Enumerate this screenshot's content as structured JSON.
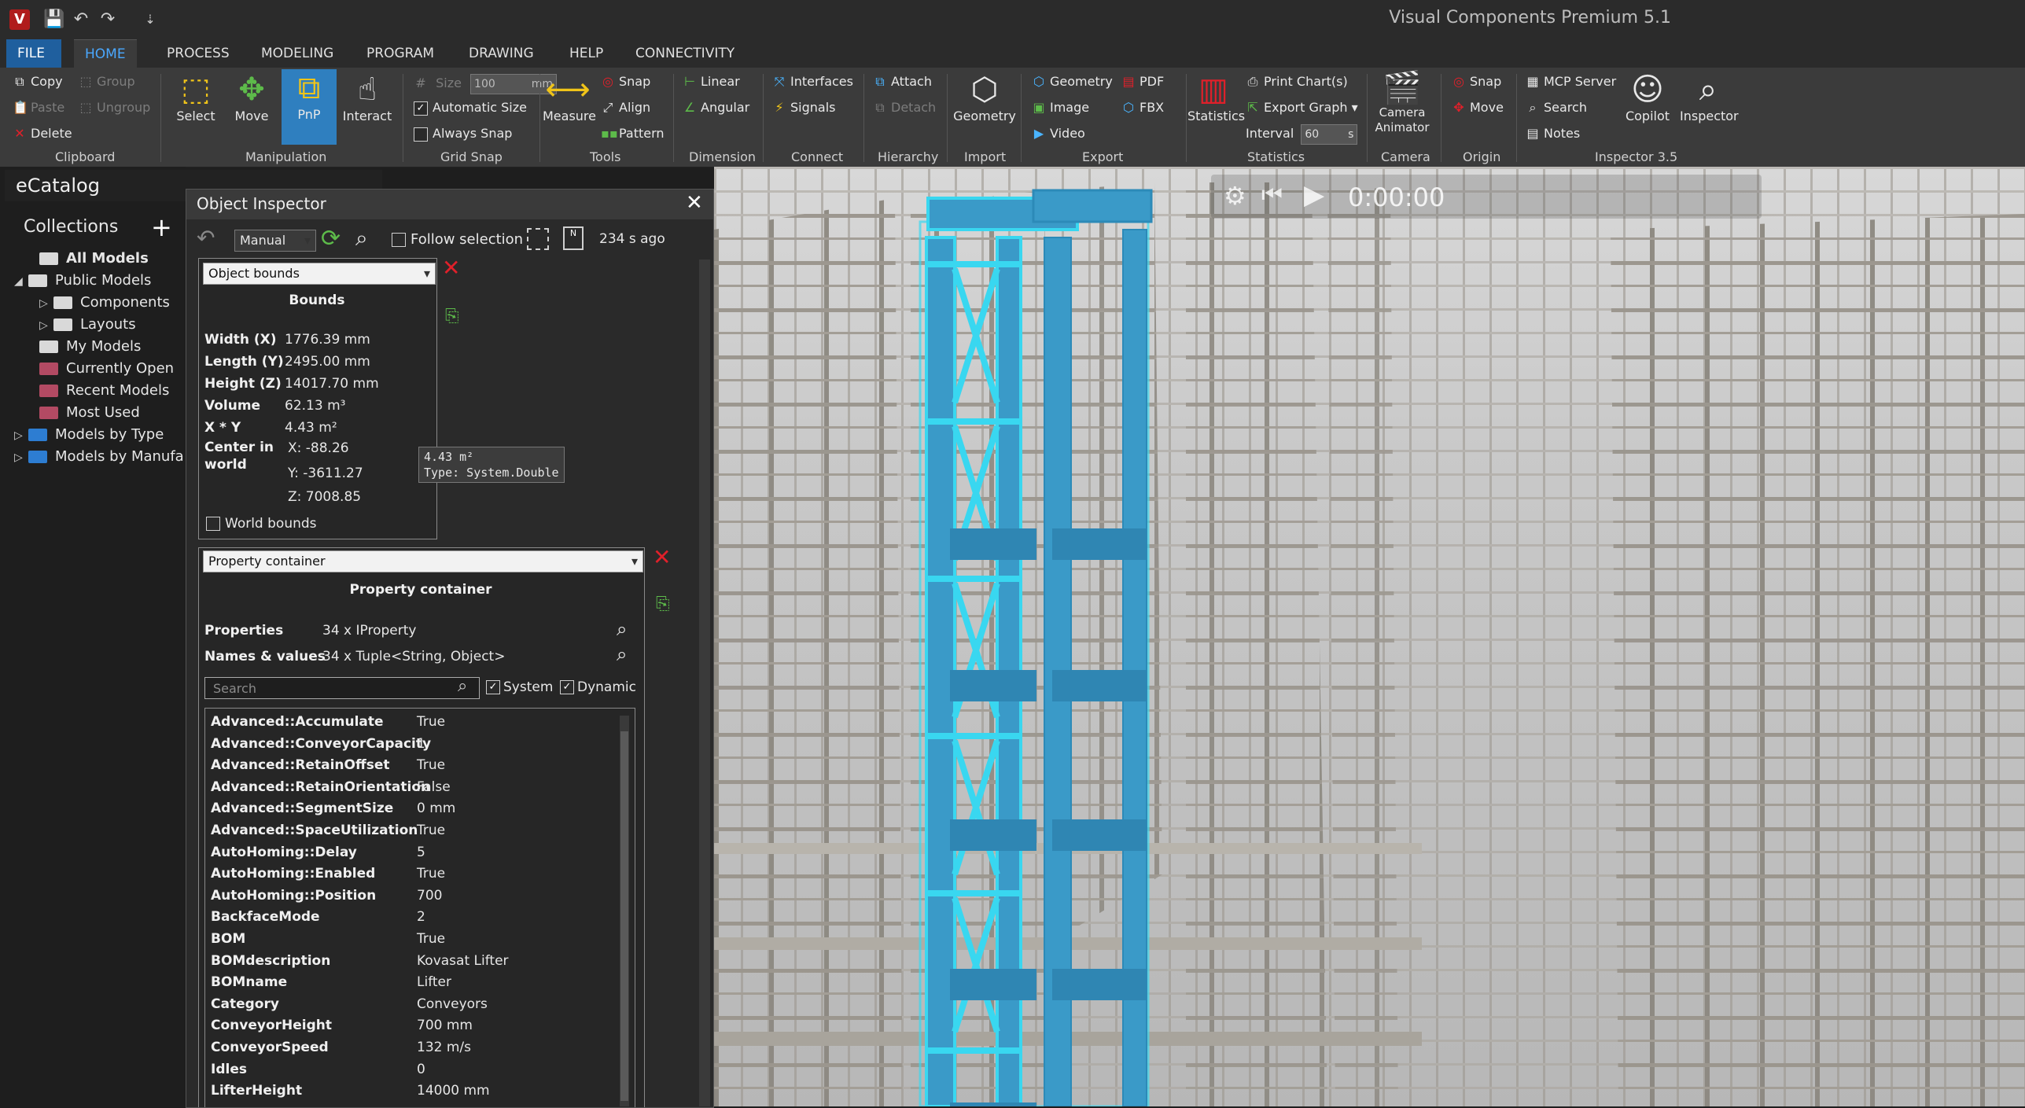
{
  "window": {
    "title": "Visual Components Premium 5.1",
    "logo": "V"
  },
  "qat": {
    "save": "💾",
    "undo": "↶",
    "redo": "↷",
    "more": "⇣"
  },
  "tabs": [
    "FILE",
    "HOME",
    "PROCESS",
    "MODELING",
    "PROGRAM",
    "DRAWING",
    "HELP",
    "CONNECTIVITY"
  ],
  "ribbon": {
    "clipboard": {
      "copy": "Copy",
      "paste": "Paste",
      "delete": "Delete",
      "group": "Group",
      "ungroup": "Ungroup",
      "label": "Clipboard"
    },
    "manipulation": {
      "select": "Select",
      "move": "Move",
      "pnp": "PnP",
      "interact": "Interact",
      "label": "Manipulation"
    },
    "grid_snap": {
      "size_label": "Size",
      "size_value": "100",
      "size_unit": "mm",
      "automatic_size": "Automatic Size",
      "always_snap": "Always Snap",
      "label": "Grid Snap"
    },
    "tools": {
      "measure": "Measure",
      "snap": "Snap",
      "align": "Align",
      "pattern": "Pattern",
      "label": "Tools"
    },
    "dimension": {
      "linear": "Linear",
      "angular": "Angular",
      "label": "Dimension"
    },
    "connect": {
      "interfaces": "Interfaces",
      "signals": "Signals",
      "label": "Connect"
    },
    "hierarchy": {
      "attach": "Attach",
      "detach": "Detach",
      "label": "Hierarchy"
    },
    "import": {
      "geometry": "Geometry",
      "label": "Import"
    },
    "export": {
      "geometry": "Geometry",
      "image": "Image",
      "video": "Video",
      "pdf": "PDF",
      "fbx": "FBX",
      "label": "Export"
    },
    "statistics": {
      "statistics": "Statistics",
      "print_charts": "Print Chart(s)",
      "export_graph": "Export Graph ▾",
      "interval_label": "Interval",
      "interval_value": "60",
      "interval_unit": "s",
      "label": "Statistics"
    },
    "camera": {
      "camera_animator": "Camera Animator",
      "label": "Camera"
    },
    "origin": {
      "snap": "Snap",
      "move": "Move",
      "label": "Origin"
    },
    "inspector": {
      "mcp_server": "MCP Server",
      "search": "Search",
      "notes": "Notes",
      "copilot": "Copilot",
      "inspector": "Inspector",
      "label": "Inspector 3.5"
    }
  },
  "ecatalog": {
    "title": "eCatalog",
    "collections_label": "Collections",
    "tree": [
      {
        "label": "All Models",
        "bold": true
      },
      {
        "label": "Public Models"
      },
      {
        "label": "Components"
      },
      {
        "label": "Layouts"
      },
      {
        "label": "My Models"
      },
      {
        "label": "Currently Open"
      },
      {
        "label": "Recent Models"
      },
      {
        "label": "Most Used"
      },
      {
        "label": "Models by Type"
      },
      {
        "label": "Models by Manufa"
      }
    ]
  },
  "inspector": {
    "title": "Object Inspector",
    "mode": "Manual",
    "follow_selection": "Follow selection",
    "age": "234 s ago",
    "bounds_panel": {
      "selector": "Object bounds",
      "heading": "Bounds",
      "rows": [
        {
          "k": "Width  (X)",
          "v": "1776.39 mm"
        },
        {
          "k": "Length (Y)",
          "v": "2495.00 mm"
        },
        {
          "k": "Height (Z)",
          "v": "14017.70 mm"
        },
        {
          "k": "Volume",
          "v": "62.13 m³"
        },
        {
          "k": "X * Y",
          "v": "4.43 m²"
        }
      ],
      "center_label": "Center in world",
      "center_x": "X: -88.26",
      "center_y": "Y: -3611.27",
      "center_z": "Z: 7008.85",
      "world_bounds": "World bounds"
    },
    "tooltip": {
      "line1": "4.43 m²",
      "line2": "Type: System.Double"
    },
    "property_panel": {
      "selector": "Property container",
      "heading": "Property container",
      "properties_label": "Properties",
      "properties_value": "34 x IProperty",
      "names_label": "Names & values",
      "names_value": "34 x Tuple<String, Object>",
      "search_placeholder": "Search",
      "system_label": "System",
      "dynamic_label": "Dynamic",
      "rows": [
        {
          "k": "Advanced::Accumulate",
          "v": "True"
        },
        {
          "k": "Advanced::ConveyorCapacity",
          "v": "1"
        },
        {
          "k": "Advanced::RetainOffset",
          "v": "True"
        },
        {
          "k": "Advanced::RetainOrientation",
          "v": "False"
        },
        {
          "k": "Advanced::SegmentSize",
          "v": "0 mm"
        },
        {
          "k": "Advanced::SpaceUtilization",
          "v": "True"
        },
        {
          "k": "AutoHoming::Delay",
          "v": "5"
        },
        {
          "k": "AutoHoming::Enabled",
          "v": "True"
        },
        {
          "k": "AutoHoming::Position",
          "v": "700"
        },
        {
          "k": "BackfaceMode",
          "v": "2"
        },
        {
          "k": "BOM",
          "v": "True"
        },
        {
          "k": "BOMdescription",
          "v": "Kovasat Lifter"
        },
        {
          "k": "BOMname",
          "v": "Lifter"
        },
        {
          "k": "Category",
          "v": "Conveyors"
        },
        {
          "k": "ConveyorHeight",
          "v": "700 mm"
        },
        {
          "k": "ConveyorSpeed",
          "v": "132 m/s"
        },
        {
          "k": "Idles",
          "v": "0"
        },
        {
          "k": "LifterHeight",
          "v": "14000 mm"
        }
      ]
    }
  },
  "simulation": {
    "time": "0:00:00"
  },
  "colors": {
    "accent": "#4aa8ff",
    "file_tab": "#1f5f9e",
    "selection": "#39d7f0",
    "lifter": "#3a9ac8"
  }
}
